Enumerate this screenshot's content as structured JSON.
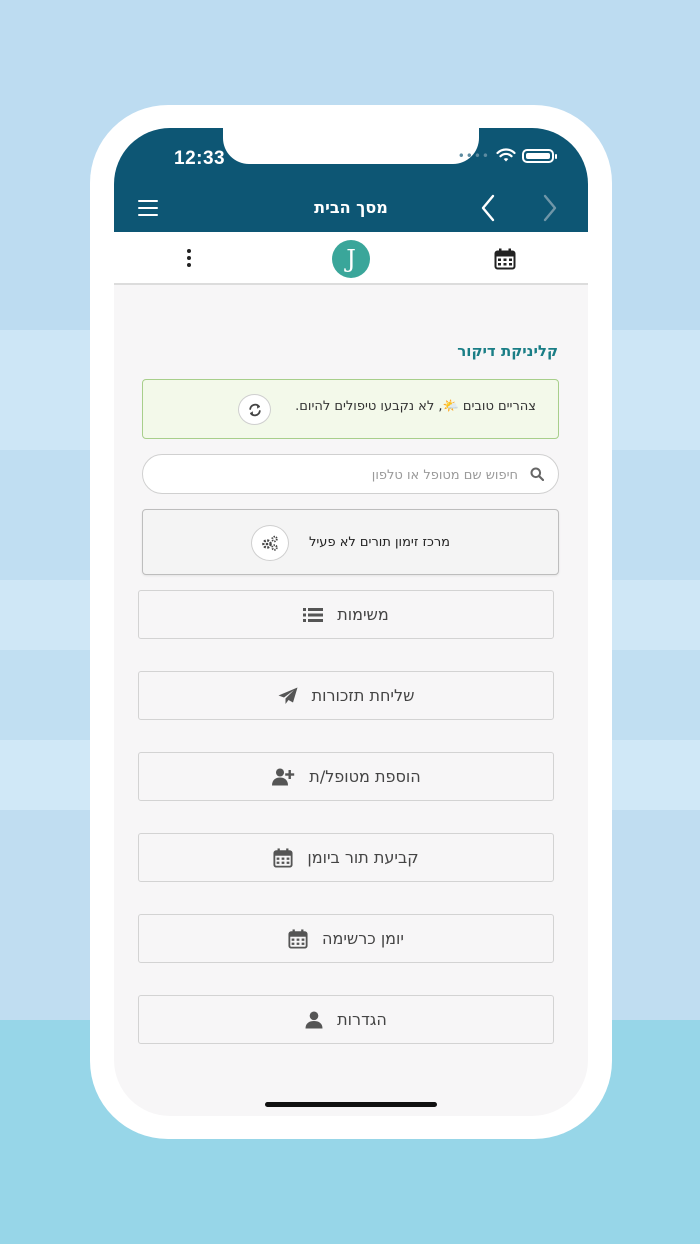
{
  "status_bar": {
    "time": "12:33"
  },
  "header": {
    "title": "מסך הבית"
  },
  "toolbar": {
    "logo_letter": "J"
  },
  "clinic": {
    "name": "קליניקת דיקור"
  },
  "greeting": {
    "text": "צהריים טובים 🌤️, לא נקבעו טיפולים להיום."
  },
  "search": {
    "placeholder": "חיפוש שם מטופל או טלפון",
    "value": ""
  },
  "booking_center": {
    "label": "מרכז זימון תורים לא פעיל"
  },
  "menu": {
    "items": [
      {
        "label": "משימות",
        "icon": "list-icon"
      },
      {
        "label": "שליחת תזכורות",
        "icon": "paper-plane-icon"
      },
      {
        "label": "הוספת מטופל/ת",
        "icon": "user-plus-icon"
      },
      {
        "label": "קביעת תור ביומן",
        "icon": "calendar-icon"
      },
      {
        "label": "יומן כרשימה",
        "icon": "calendar-icon"
      },
      {
        "label": "הגדרות",
        "icon": "user-icon"
      }
    ]
  },
  "colors": {
    "header_bg": "#0d5674",
    "accent": "#1a7e86",
    "logo_bg": "#3aa69a",
    "greeting_bg": "#f3f9ea",
    "greeting_border": "#a8cf8b"
  }
}
